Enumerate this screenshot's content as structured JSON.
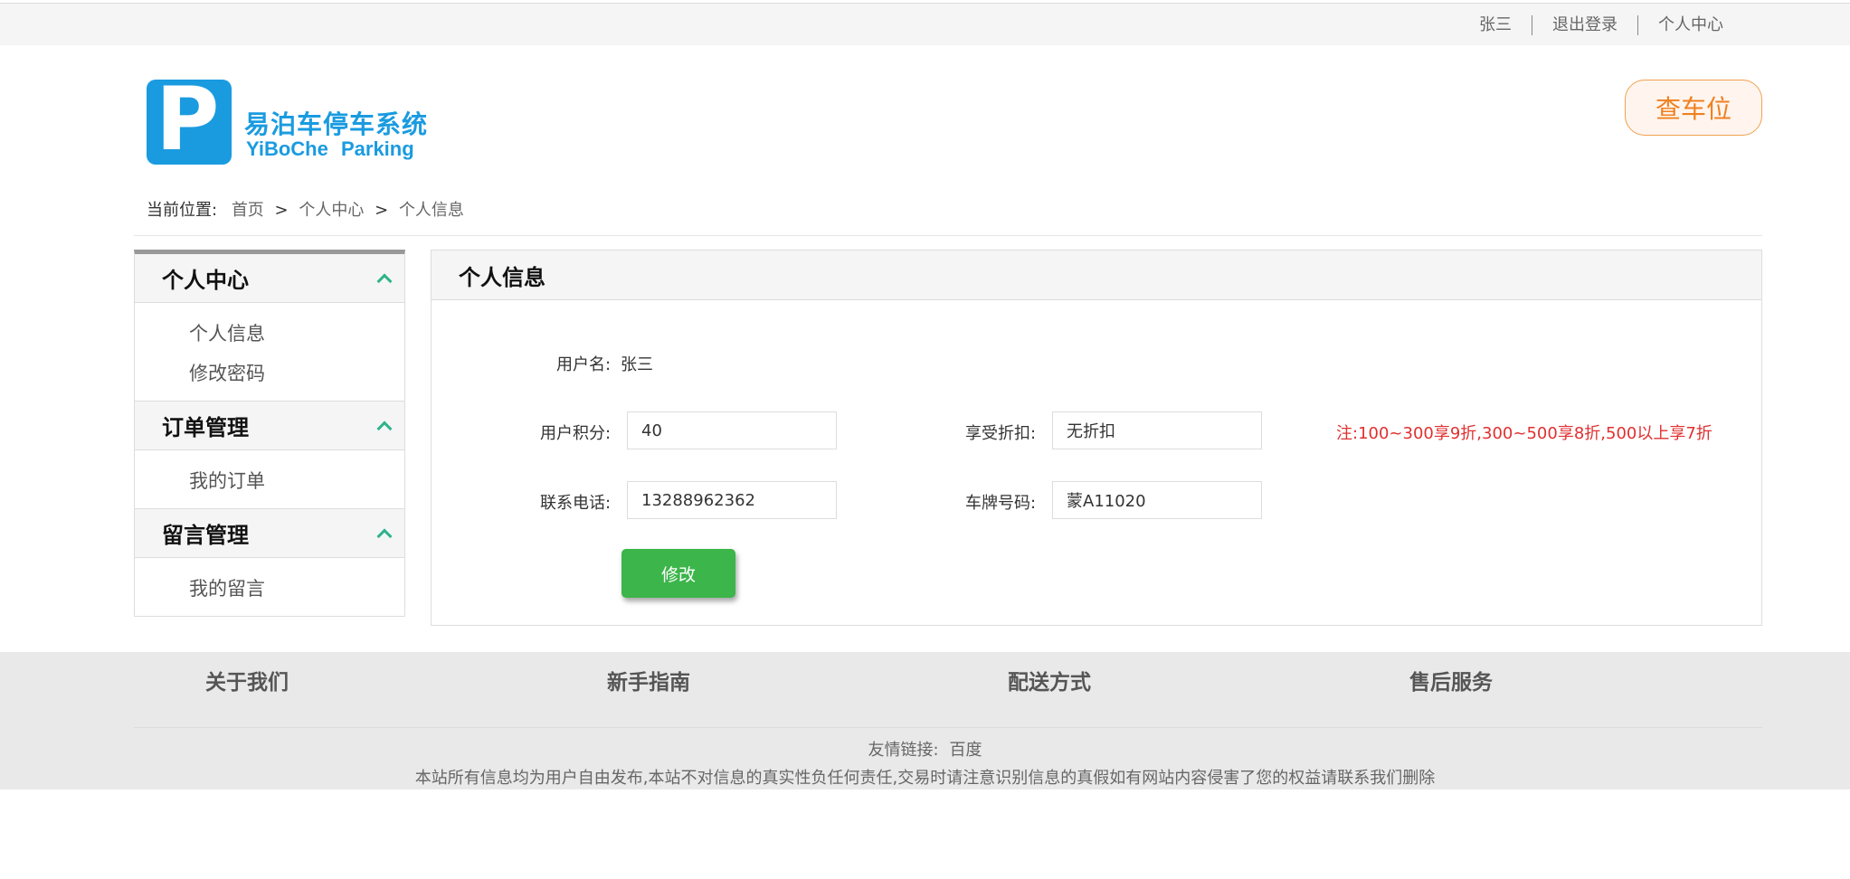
{
  "topbar": {
    "username": "张三",
    "logout": "退出登录",
    "personal_center": "个人中心"
  },
  "logo": {
    "mark": "P",
    "title_cn": "易泊车停车系统",
    "title_en": "YiBoChe Parking"
  },
  "find_spot_button": "查车位",
  "breadcrumb": {
    "label": "当前位置:",
    "items": [
      "首页",
      "个人中心",
      "个人信息"
    ],
    "separator": ">"
  },
  "sidebar": {
    "sections": [
      {
        "title": "个人中心",
        "items": [
          "个人信息",
          "修改密码"
        ]
      },
      {
        "title": "订单管理",
        "items": [
          "我的订单"
        ]
      },
      {
        "title": "留言管理",
        "items": [
          "我的留言"
        ]
      }
    ]
  },
  "panel": {
    "title": "个人信息",
    "username_label": "用户名:",
    "username_value": "张三",
    "points_label": "用户积分:",
    "points_value": "40",
    "discount_label": "享受折扣:",
    "discount_value": "无折扣",
    "note": "注:100~300享9折,300~500享8折,500以上享7折",
    "phone_label": "联系电话:",
    "phone_value": "13288962362",
    "plate_label": "车牌号码:",
    "plate_value": "蒙A11020",
    "submit_label": "修改"
  },
  "footer": {
    "columns": [
      "关于我们",
      "新手指南",
      "配送方式",
      "售后服务"
    ],
    "friend_label": "友情链接:",
    "friend_link": "百度",
    "copyright": "本站所有信息均为用户自由发布,本站不对信息的真实性负任何责任,交易时请注意识别信息的真假如有网站内容侵害了您的权益请联系我们删除"
  },
  "colors": {
    "brand_blue": "#1a9be0",
    "accent_orange": "#f08020",
    "button_green": "#3cb54a",
    "chevron_teal": "#2db38a",
    "note_red": "#e03030"
  }
}
